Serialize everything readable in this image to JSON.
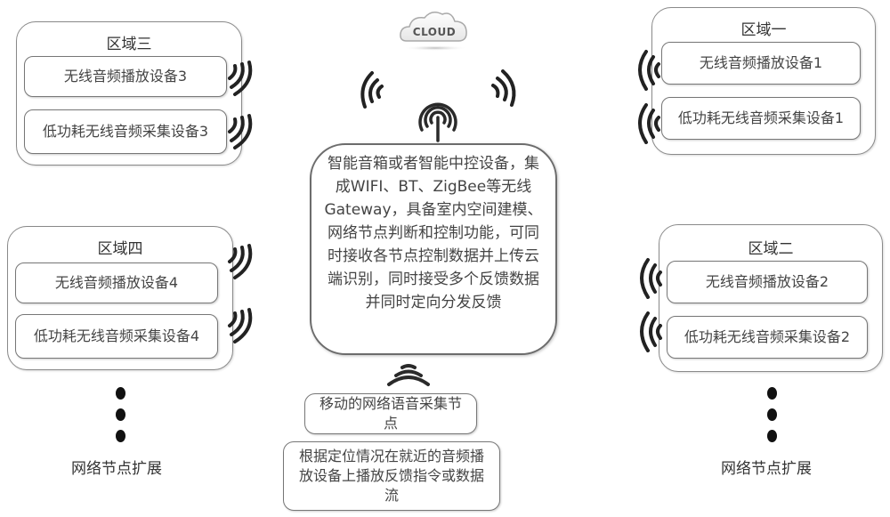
{
  "cloud": {
    "label": "CLOUD",
    "icon": "cloud-icon"
  },
  "hub": {
    "icon": "antenna-broadcast-icon",
    "text": "智能音箱或者智能中控设备，集成WIFI、BT、ZigBee等无线Gateway，具备室内空间建模、网络节点判断和控制功能，可同时接收各节点控制数据并上传云端识别，同时接受多个反馈数据并同时定向分发反馈"
  },
  "regions": [
    {
      "id": "region-3",
      "title": "区域三",
      "devices": [
        "无线音频播放设备3",
        "低功耗无线音频采集设备3"
      ]
    },
    {
      "id": "region-1",
      "title": "区域一",
      "devices": [
        "无线音频播放设备1",
        "低功耗无线音频采集设备1"
      ]
    },
    {
      "id": "region-4",
      "title": "区域四",
      "devices": [
        "无线音频播放设备4",
        "低功耗无线音频采集设备4"
      ]
    },
    {
      "id": "region-2",
      "title": "区域二",
      "devices": [
        "无线音频播放设备2",
        "低功耗无线音频采集设备2"
      ]
    }
  ],
  "mobile_node": {
    "label": "移动的网络语音采集节点",
    "icon": "wifi-signal-icon"
  },
  "playback_note": {
    "label": "根据定位情况在就近的音频播放设备上播放反馈指令或数据流"
  },
  "extensions": [
    {
      "label": "网络节点扩展"
    },
    {
      "label": "网络节点扩展"
    }
  ]
}
